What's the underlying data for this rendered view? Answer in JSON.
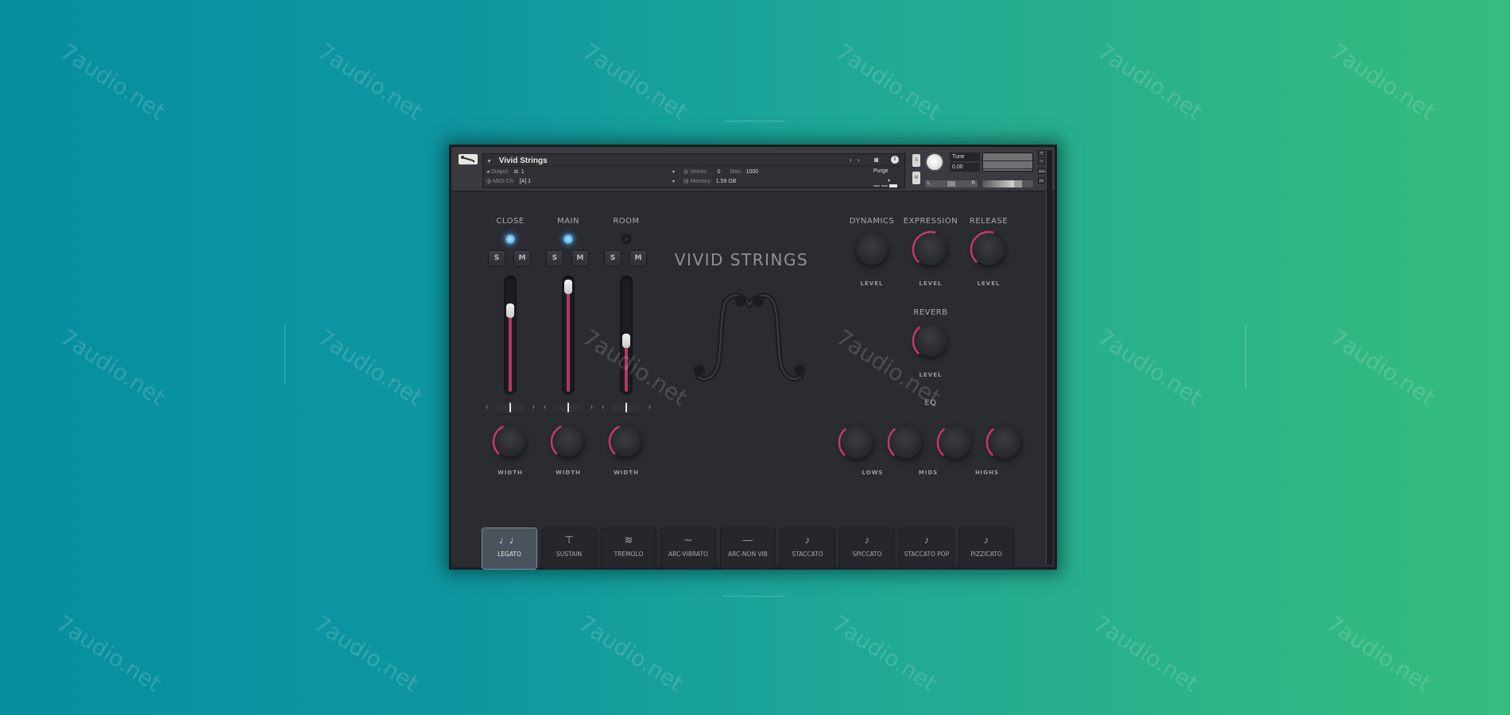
{
  "watermark": "7audio.net",
  "header": {
    "instrument_name": "Vivid Strings",
    "output_label": "Output:",
    "output_value": "st. 1",
    "midi_label": "MIDI Ch:",
    "midi_value": "[A] 1",
    "voices_label": "Voices:",
    "voices_value": "0",
    "max_label": "Max:",
    "max_value": "1000",
    "memory_label": "Memory:",
    "memory_value": "1.59 GB",
    "purge_label": "Purge",
    "tune_label": "Tune",
    "tune_value": "0.00",
    "solo_btn": "S",
    "mute_btn": "M",
    "pan_l": "L",
    "pan_r": "R",
    "aux_label": "AUX",
    "pv_label": "PV"
  },
  "mixer": {
    "channels": [
      {
        "label": "CLOSE",
        "active": true,
        "solo": "S",
        "mute": "M",
        "fader_level": 0.72,
        "pan": 0.5,
        "width_label": "WIDTH",
        "width_value": 0.4
      },
      {
        "label": "MAIN",
        "active": true,
        "solo": "S",
        "mute": "M",
        "fader_level": 0.93,
        "pan": 0.5,
        "width_label": "WIDTH",
        "width_value": 0.4
      },
      {
        "label": "ROOM",
        "active": false,
        "solo": "S",
        "mute": "M",
        "fader_level": 0.45,
        "pan": 0.5,
        "width_label": "WIDTH",
        "width_value": 0.4
      }
    ]
  },
  "title": "VIVID STRINGS",
  "controls": {
    "dynamics": {
      "label": "DYNAMICS",
      "sub": "LEVEL",
      "value": 0.0
    },
    "expression": {
      "label": "EXPRESSION",
      "sub": "LEVEL",
      "value": 0.55
    },
    "release": {
      "label": "RELEASE",
      "sub": "LEVEL",
      "value": 0.55
    },
    "reverb": {
      "label": "REVERB",
      "sub": "LEVEL",
      "value": 0.35
    },
    "eq": {
      "label": "EQ",
      "knobs": [
        {
          "sub": "LOWS",
          "value": 0.35
        },
        {
          "sub": "",
          "value": 0.35
        },
        {
          "sub": "MIDS",
          "value": 0.35
        },
        {
          "sub": "HIGHS",
          "value": 0.35
        }
      ]
    }
  },
  "articulations": [
    {
      "label": "LEGATO",
      "icon": "legato-notes-icon",
      "glyph": "♩♩",
      "selected": true
    },
    {
      "label": "SUSTAIN",
      "icon": "sustain-note-icon",
      "glyph": "⊤",
      "selected": false
    },
    {
      "label": "TREMOLO",
      "icon": "tremolo-icon",
      "glyph": "≋",
      "selected": false
    },
    {
      "label": "ARC-VIBRATO",
      "icon": "vibrato-wave-icon",
      "glyph": "∼",
      "selected": false
    },
    {
      "label": "ARC-NON VIB",
      "icon": "straight-line-icon",
      "glyph": "—",
      "selected": false
    },
    {
      "label": "STACCATO",
      "icon": "staccato-note-icon",
      "glyph": "♪",
      "selected": false
    },
    {
      "label": "SPICCATO",
      "icon": "spiccato-note-icon",
      "glyph": "♪",
      "selected": false
    },
    {
      "label": "STACCATO POP",
      "icon": "staccato-pop-note-icon",
      "glyph": "♪",
      "selected": false
    },
    {
      "label": "PIZZICATO",
      "icon": "pizzicato-note-icon",
      "glyph": "♪",
      "selected": false
    }
  ],
  "colors": {
    "accent": "#c23d67",
    "led_on": "#5fb6f6",
    "panel": "#2a2c32"
  }
}
